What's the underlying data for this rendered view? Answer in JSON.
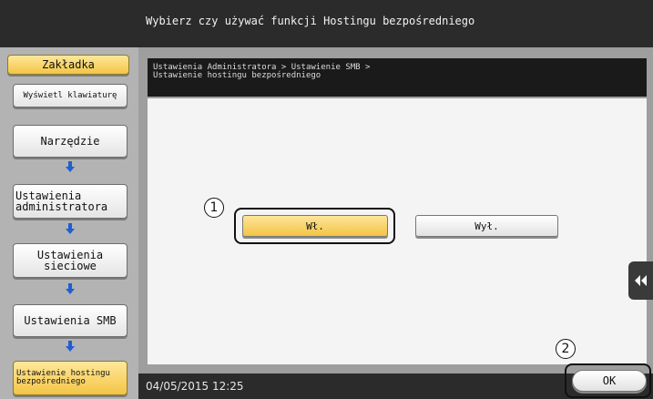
{
  "header": {
    "title": "Wybierz czy używać funkcji Hostingu bezpośredniego"
  },
  "sidebar": {
    "bookmark_label": "Zakładka",
    "keyboard_label": "Wyświetl klawiaturę",
    "path": [
      {
        "label": "Narzędzie"
      },
      {
        "label": "Ustawienia administratora"
      },
      {
        "label": "Ustawienia sieciowe"
      },
      {
        "label": "Ustawienia SMB"
      },
      {
        "label": "Ustawienie hostingu bezpośredniego"
      }
    ]
  },
  "breadcrumb": {
    "text": "Ustawienia Administratora > Ustawienie SMB >\nUstawienie hostingu bezpośredniego"
  },
  "options": {
    "on_label": "Wł.",
    "off_label": "Wył."
  },
  "callouts": {
    "first": "1",
    "second": "2"
  },
  "footer": {
    "datetime": "04/05/2015   12:25",
    "ok_label": "OK"
  },
  "colors": {
    "accent": "#f3c545",
    "dark": "#2b2b2b",
    "panel": "#9e9e9e"
  }
}
